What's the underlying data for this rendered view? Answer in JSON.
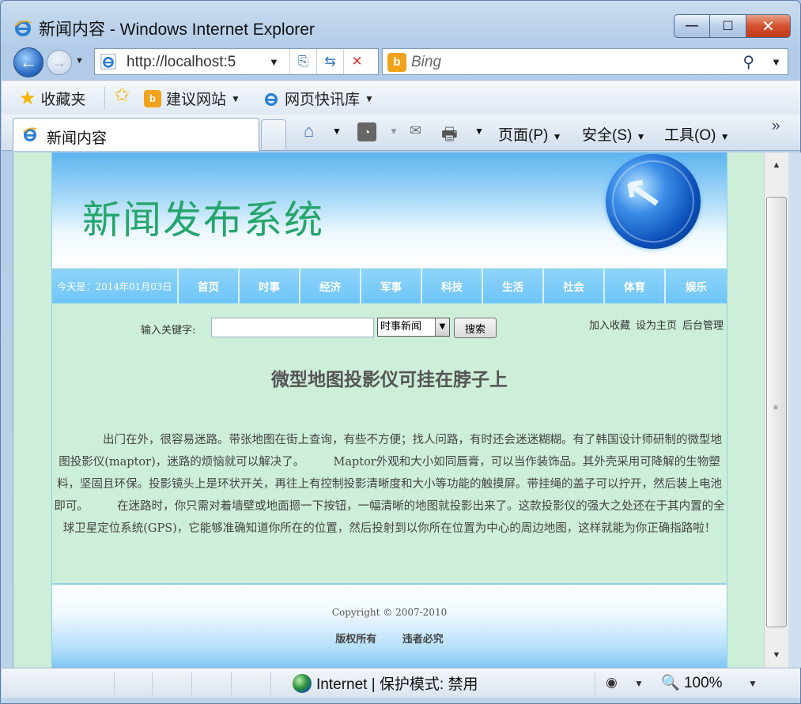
{
  "window": {
    "title": "新闻内容 - Windows Internet Explorer",
    "min_label": "—",
    "max_label": "☐",
    "close_label": "✕"
  },
  "addressbar": {
    "url": "http://localhost:5",
    "search_placeholder": "Bing"
  },
  "favorites": {
    "label": "收藏夹",
    "items": [
      "建议网站",
      "网页快讯库"
    ]
  },
  "tab": {
    "label": "新闻内容"
  },
  "commands": {
    "page": "页面(P)",
    "safety": "安全(S)",
    "tools": "工具(O)",
    "more": "»"
  },
  "site": {
    "banner_title": "新闻发布系统",
    "date_label": "今天是：2014年01月03日",
    "nav": [
      "首页",
      "时事",
      "经济",
      "军事",
      "科技",
      "生活",
      "社会",
      "体育",
      "娱乐"
    ],
    "search": {
      "keyword_label": "输入关键字:",
      "keyword_value": "",
      "category_selected": "时事新闻",
      "button_label": "搜索"
    },
    "toplinks": [
      "加入收藏",
      "设为主页",
      "后台管理"
    ],
    "article": {
      "title": "微型地图投影仪可挂在脖子上",
      "body": "　　　　出门在外，很容易迷路。带张地图在街上查询，有些不方便；找人问路，有时还会迷迷糊糊。有了韩国设计师研制的微型地图投影仪(maptor)，迷路的烦恼就可以解决了。　　　Maptor外观和大小如同唇膏，可以当作装饰品。其外壳采用可降解的生物塑料，坚固且环保。投影镜头上是环状开关，再往上有控制投影清晰度和大小等功能的触摸屏。带挂绳的盖子可以拧开，然后装上电池即可。　　　在迷路时，你只需对着墙壁或地面摁一下按钮，一幅清晰的地图就投影出来了。这款投影仪的强大之处还在于其内置的全球卫星定位系统(GPS)，它能够准确知道你所在的位置，然后投射到以你所在位置为中心的周边地图，这样就能为你正确指路啦！"
    },
    "footer": {
      "copyright": "Copyright © 2007-2010",
      "rights": [
        "版权所有",
        "违者必究"
      ]
    }
  },
  "statusbar": {
    "zone": "Internet | 保护模式: 禁用",
    "zoom": "100%"
  },
  "colors": {
    "page_bg": "#cdeed9",
    "banner_title": "#25a56c",
    "nav_bg": "#6ec5f7"
  }
}
